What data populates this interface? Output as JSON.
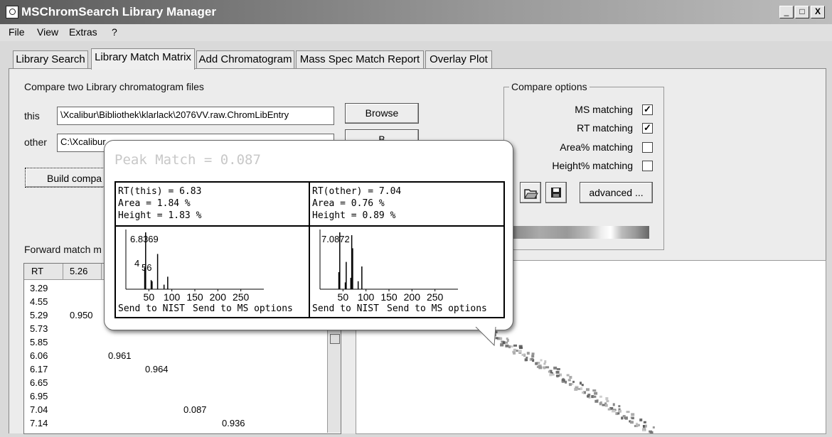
{
  "window": {
    "title": "MSChromSearch Library Manager",
    "buttons": [
      "_",
      "□",
      "X"
    ]
  },
  "menu": [
    "File",
    "View",
    "Extras",
    "?"
  ],
  "tabs": [
    {
      "label": "Library Search",
      "active": false
    },
    {
      "label": "Library Match Matrix",
      "active": true
    },
    {
      "label": "Add Chromatogram",
      "active": false
    },
    {
      "label": "Mass Spec Match Report",
      "active": false
    },
    {
      "label": "Overlay Plot",
      "active": false
    }
  ],
  "compare": {
    "heading": "Compare two Library chromatogram files",
    "this_label": "this",
    "this_value": "\\Xcalibur\\Bibliothek\\klarlack\\2076VV.raw.ChromLibEntry",
    "other_label": "other",
    "other_value": "C:\\Xcalibur",
    "browse_label": "Browse",
    "browse2_label": "B",
    "build_label": "Build compa"
  },
  "options": {
    "title": "Compare options",
    "items": [
      {
        "label": "MS matching",
        "checked": true
      },
      {
        "label": "RT matching",
        "checked": true
      },
      {
        "label": "Area% matching",
        "checked": false
      },
      {
        "label": "Height% matching",
        "checked": false
      }
    ],
    "advanced_label": "advanced ...",
    "open_icon": "folder-open-icon",
    "save_icon": "floppy-save-icon"
  },
  "matrix": {
    "label": "Forward match m",
    "headers": [
      "RT",
      "5.26"
    ],
    "rows": [
      {
        "rt": "3.29",
        "value": ""
      },
      {
        "rt": "4.55",
        "value": ""
      },
      {
        "rt": "5.29",
        "value": "0.950"
      },
      {
        "rt": "5.73",
        "value": ""
      },
      {
        "rt": "5.85",
        "value": ""
      },
      {
        "rt": "6.06",
        "value": "0.961"
      },
      {
        "rt": "6.17",
        "value": "0.964"
      },
      {
        "rt": "6.65",
        "value": ""
      },
      {
        "rt": "6.95",
        "value": ""
      },
      {
        "rt": "7.04",
        "value": "0.087"
      },
      {
        "rt": "7.14",
        "value": "0.936"
      }
    ]
  },
  "popup": {
    "title": "Peak Match = 0.087",
    "this": {
      "info": "RT(this) = 6.83\nArea = 1.84 %\nHeight = 1.83 %",
      "peak_labels": [
        "6.8369",
        "4",
        "56"
      ],
      "ticks": [
        "50",
        "100",
        "150",
        "200",
        "250"
      ],
      "link1": "Send to NIST",
      "link2": "Send to MS options"
    },
    "other": {
      "info": "RT(other) = 7.04\nArea = 0.76 %\nHeight = 0.89 %",
      "peak_labels": [
        "7.0872"
      ],
      "ticks": [
        "50",
        "100",
        "150",
        "200",
        "250"
      ],
      "link1": "Send to NIST",
      "link2": "Send to MS options"
    }
  },
  "chart_data": [
    {
      "type": "bar",
      "x": [
        41,
        43,
        55,
        56,
        57,
        69,
        83,
        91
      ],
      "values": [
        38,
        100,
        16,
        12,
        14,
        62,
        8,
        22
      ],
      "xlim": [
        0,
        300
      ],
      "xticks": [
        50,
        100,
        150,
        200,
        250
      ]
    },
    {
      "type": "bar",
      "x": [
        41,
        43,
        55,
        57,
        67,
        69,
        71,
        83,
        91
      ],
      "values": [
        30,
        100,
        12,
        48,
        20,
        95,
        72,
        14,
        40
      ],
      "xlim": [
        0,
        300
      ],
      "xticks": [
        50,
        100,
        150,
        200,
        250
      ]
    }
  ]
}
